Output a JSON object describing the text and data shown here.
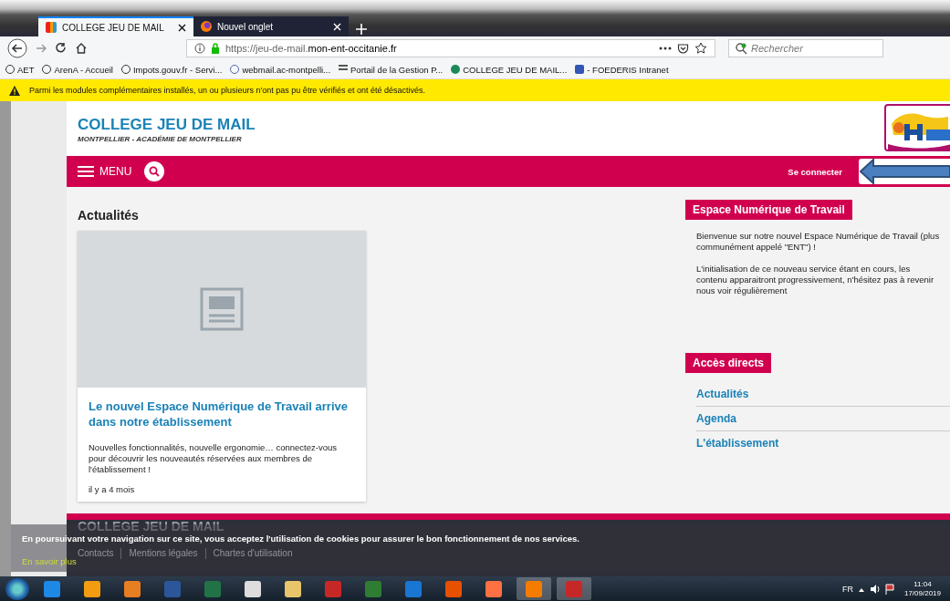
{
  "browser": {
    "tabs": [
      {
        "title": "COLLEGE JEU DE MAIL",
        "selected": true
      },
      {
        "title": "Nouvel onglet",
        "selected": false
      }
    ],
    "url": {
      "prefix": "https://jeu-de-mail.",
      "domain": "mon-ent-occitanie.fr"
    },
    "search": {
      "placeholder": "Rechercher"
    },
    "bookmarks": [
      "AET",
      "ArenA - Accueil",
      "Impots.gouv.fr - Servi...",
      "webmail.ac-montpelli...",
      "Portail de la Gestion P...",
      "COLLEGE JEU DE MAIL...",
      "- FOEDERIS Intranet"
    ],
    "notification": "Parmi les modules complémentaires installés, un ou plusieurs n'ont pas pu être vérifiés et ont été désactivés."
  },
  "site": {
    "title": "COLLEGE JEU DE MAIL",
    "subtitle": "MONTPELLIER - ACADÉMIE DE MONTPELLIER",
    "menu": "MENU",
    "login": "Se connecter",
    "news_heading": "Actualités",
    "article": {
      "title": "Le nouvel Espace Numérique de Travail arrive dans notre établissement",
      "summary": "Nouvelles fonctionnalités, nouvelle ergonomie… connectez-vous pour découvrir les nouveautés réservées aux membres de l'établissement !",
      "date": "il y a 4 mois"
    },
    "ent": {
      "heading": "Espace Numérique de Travail",
      "paragraphs": [
        "Bienvenue sur notre nouvel Espace Numérique de Travail (plus communément appelé \"ENT\") !",
        "L'initialisation de ce nouveau service étant en cours, les contenu apparaitront progressivement, n'hésitez pas à revenir nous voir régulièrement"
      ]
    },
    "quick": {
      "heading": "Accès directs",
      "links": [
        "Actualités",
        "Agenda",
        "L'établissement"
      ]
    },
    "footer": {
      "title": "COLLEGE JEU DE MAIL",
      "links": [
        "Contacts",
        "Mentions légales",
        "Chartes d'utilisation"
      ]
    },
    "cookie": {
      "text": "En poursuivant votre navigation sur ce site, vous acceptez l'utilisation de cookies pour assurer le bon fonctionnement de nos services.",
      "link": "En savoir plus"
    }
  },
  "taskbar": {
    "language": "FR",
    "time": "11:04",
    "date": "17/09/2019"
  }
}
